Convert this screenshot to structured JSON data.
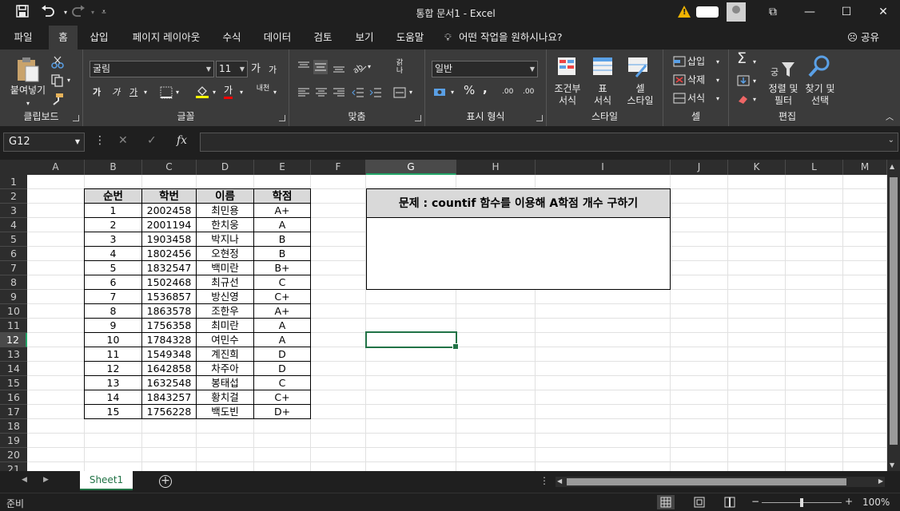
{
  "window": {
    "title": "통합 문서1  -  Excel",
    "minimize": "—",
    "maximize": "☐",
    "close": "✕",
    "restore_ribbon": "⧉",
    "warning_icon": "!"
  },
  "qat": {
    "save_icon": "save-icon",
    "undo_icon": "undo-icon",
    "redo_icon": "redo-icon"
  },
  "menu": {
    "tabs": [
      "파일",
      "홈",
      "삽입",
      "페이지 레이아웃",
      "수식",
      "데이터",
      "검토",
      "보기",
      "도움말"
    ],
    "active": "홈",
    "tellme": "어떤 작업을 원하시나요?",
    "share": "공유"
  },
  "ribbon": {
    "clipboard": {
      "label": "클립보드",
      "paste": "붙여넣기"
    },
    "font": {
      "label": "글꼴",
      "font_name": "굴림",
      "font_size": "11",
      "grow": "가",
      "shrink": "가",
      "bold": "가",
      "italic": "가",
      "underline": "가",
      "font_color": "가",
      "phonetic": "내천"
    },
    "alignment": {
      "label": "맞춤",
      "wrap": "갉나"
    },
    "number": {
      "label": "표시 형식",
      "format": "일반",
      "percent": "%",
      "comma": ",",
      "inc_decimal": ".00",
      "dec_decimal": ".00"
    },
    "styles": {
      "label": "스타일",
      "conditional": "조건부\n서식",
      "table": "표\n서식",
      "cell_style": "셀\n스타일"
    },
    "cells": {
      "label": "셀",
      "insert": "삽입",
      "delete": "삭제",
      "format": "서식"
    },
    "editing": {
      "label": "편집",
      "sort": "정렬 및\n필터",
      "find": "찾기 및\n선택",
      "sigma": "Σ"
    }
  },
  "formula_bar": {
    "name_box": "G12",
    "fx": "fx",
    "cancel": "✕",
    "enter": "✓",
    "value": ""
  },
  "columns": [
    {
      "name": "A",
      "w": 72
    },
    {
      "name": "B",
      "w": 72
    },
    {
      "name": "C",
      "w": 68
    },
    {
      "name": "D",
      "w": 72
    },
    {
      "name": "E",
      "w": 71
    },
    {
      "name": "F",
      "w": 69
    },
    {
      "name": "G",
      "w": 113
    },
    {
      "name": "H",
      "w": 99
    },
    {
      "name": "I",
      "w": 169
    },
    {
      "name": "J",
      "w": 72
    },
    {
      "name": "K",
      "w": 72
    },
    {
      "name": "L",
      "w": 72
    },
    {
      "name": "M",
      "w": 55
    }
  ],
  "rows": [
    "1",
    "2",
    "3",
    "4",
    "5",
    "6",
    "7",
    "8",
    "9",
    "10",
    "11",
    "12",
    "13",
    "14",
    "15",
    "16",
    "17",
    "18",
    "19",
    "20",
    "21"
  ],
  "selected": {
    "column": "G",
    "row": "12"
  },
  "table": {
    "headers": [
      "순번",
      "학번",
      "이름",
      "학점"
    ],
    "rows": [
      [
        "1",
        "2002458",
        "최민용",
        "A+"
      ],
      [
        "2",
        "2001194",
        "한치웅",
        "A"
      ],
      [
        "3",
        "1903458",
        "박지나",
        "B"
      ],
      [
        "4",
        "1802456",
        "오현정",
        "B"
      ],
      [
        "5",
        "1832547",
        "백미란",
        "B+"
      ],
      [
        "6",
        "1502468",
        "최규선",
        "C"
      ],
      [
        "7",
        "1536857",
        "방신영",
        "C+"
      ],
      [
        "8",
        "1863578",
        "조한우",
        "A+"
      ],
      [
        "9",
        "1756358",
        "최미란",
        "A"
      ],
      [
        "10",
        "1784328",
        "여민수",
        "A"
      ],
      [
        "11",
        "1549348",
        "계진희",
        "D"
      ],
      [
        "12",
        "1642858",
        "차주아",
        "D"
      ],
      [
        "13",
        "1632548",
        "봉태섭",
        "C"
      ],
      [
        "14",
        "1843257",
        "황치걸",
        "C+"
      ],
      [
        "15",
        "1756228",
        "백도빈",
        "D+"
      ]
    ]
  },
  "problem": {
    "title": "문제 : countif 함수를 이용해 A학점 개수 구하기",
    "body": ""
  },
  "sheet_tabs": {
    "active": "Sheet1",
    "add": "+"
  },
  "status": {
    "text": "준비",
    "zoom": "100%"
  }
}
